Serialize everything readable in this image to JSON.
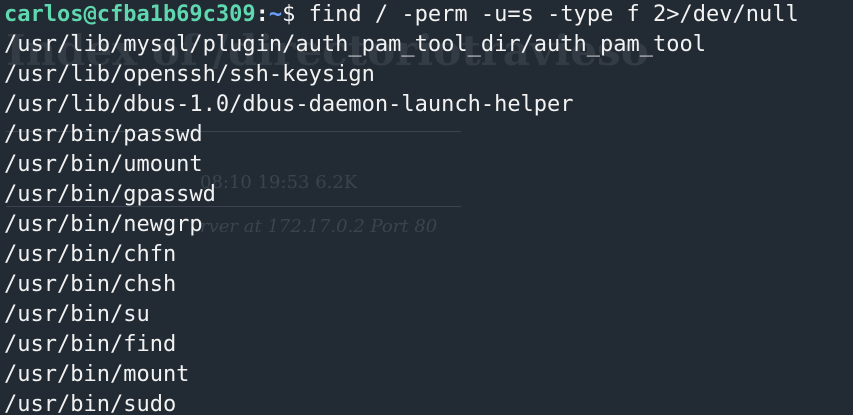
{
  "colors": {
    "background": "#222a33",
    "text": "#f2f2f2",
    "prompt_user": "#5fd7af",
    "prompt_path": "#6aa0ff"
  },
  "prompt": {
    "user_host": "carlos@cfba1b69c309",
    "separator": ":",
    "path": "~",
    "symbol": "$ ",
    "command": "find / -perm -u=s -type f 2>/dev/null"
  },
  "output": [
    "/usr/lib/mysql/plugin/auth_pam_tool_dir/auth_pam_tool",
    "/usr/lib/openssh/ssh-keysign",
    "/usr/lib/dbus-1.0/dbus-daemon-launch-helper",
    "/usr/bin/passwd",
    "/usr/bin/umount",
    "/usr/bin/gpasswd",
    "/usr/bin/newgrp",
    "/usr/bin/chfn",
    "/usr/bin/chsh",
    "/usr/bin/su",
    "/usr/bin/find",
    "/usr/bin/mount",
    "/usr/bin/sudo"
  ],
  "background_window": {
    "title": "Index of /directoriotravieso",
    "row_text": "08:10 19:53 6.2K",
    "footer": "rver at 172.17.0.2 Port 80"
  }
}
